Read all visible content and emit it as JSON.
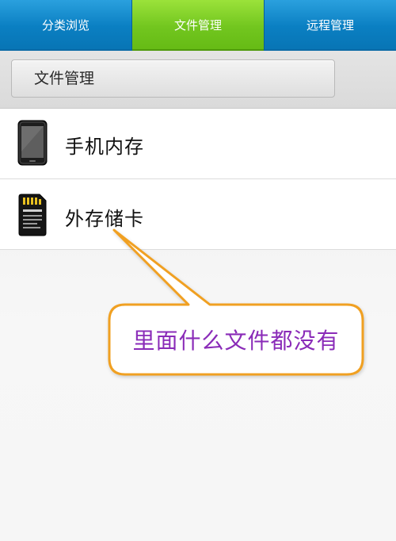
{
  "tabs": [
    {
      "label": "分类浏览",
      "active": false
    },
    {
      "label": "文件管理",
      "active": true
    },
    {
      "label": "远程管理",
      "active": false
    }
  ],
  "path_bar": {
    "label": "文件管理"
  },
  "storage_list": [
    {
      "label": "手机内存",
      "icon": "phone-icon"
    },
    {
      "label": "外存储卡",
      "icon": "sd-card-icon"
    }
  ],
  "annotation": {
    "text": "里面什么文件都没有",
    "text_color": "#8a2bb8",
    "border_color": "#f0a020"
  },
  "colors": {
    "tab_blue": "#0e87c8",
    "tab_green": "#72c61f"
  }
}
